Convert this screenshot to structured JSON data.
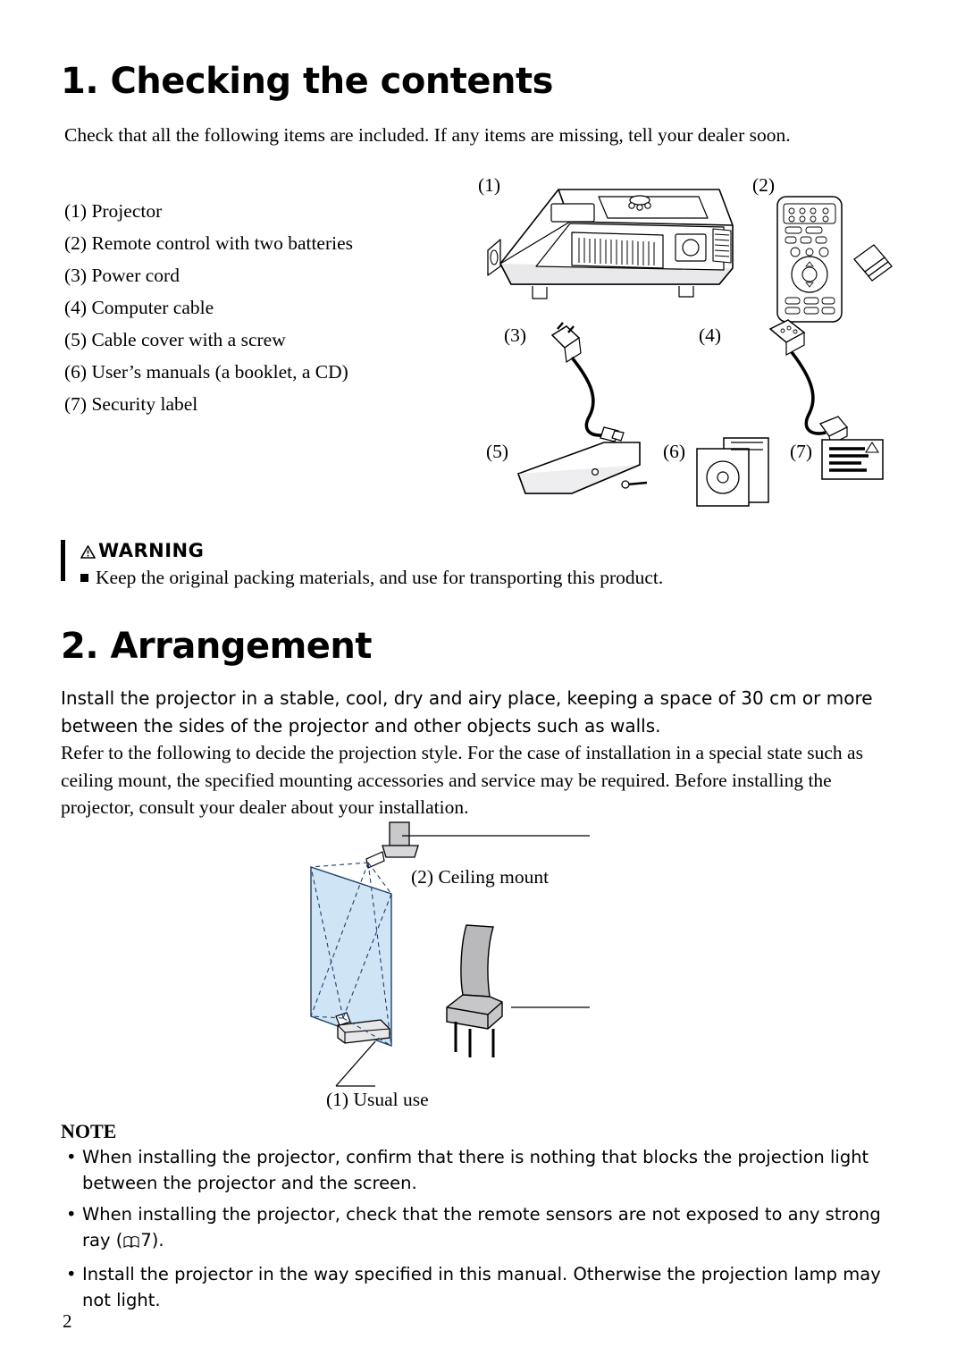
{
  "document": {
    "page_number": "2",
    "section1": {
      "heading": "1. Checking the contents",
      "intro": "Check that all the following items are included. If any items are missing, tell your dealer soon.",
      "items": [
        "(1) Projector",
        "(2) Remote control with two batteries",
        "(3) Power cord",
        "(4) Computer cable",
        "(5) Cable cover with a screw",
        "(6) User’s manuals (a booklet, a CD)",
        "(7) Security label"
      ],
      "figure_numbers": [
        "(1)",
        "(2)",
        "(3)",
        "(4)",
        "(5)",
        "(6)",
        "(7)"
      ],
      "warning": {
        "title": "WARNING",
        "text": "Keep the original packing materials, and use for transporting this product."
      }
    },
    "section2": {
      "heading": "2. Arrangement",
      "paragraph1": "Install the projector in a stable, cool, dry and airy place, keeping a space of 30 cm or more between the sides of the projector and other objects such as walls.",
      "paragraph2": "Refer to the following to decide the projection style. For the case of installation in a special state such as ceiling mount, the specified mounting accessories and service may be required. Before installing the projector, consult your dealer about your installation.",
      "figure_labels": {
        "ceiling": "(2) Ceiling mount",
        "usual": "(1) Usual use"
      },
      "note": {
        "title": "NOTE",
        "items": [
          "When installing the projector, confirm that there is nothing that blocks the projection light between the projector and the screen.",
          "When installing the projector, check that the remote sensors are not exposed to any strong ray (",
          "Install the projector in the way specified in this manual. Otherwise the projection lamp may not light."
        ],
        "item2_suffix": "7).",
        "book_icon": "book-icon"
      }
    }
  }
}
